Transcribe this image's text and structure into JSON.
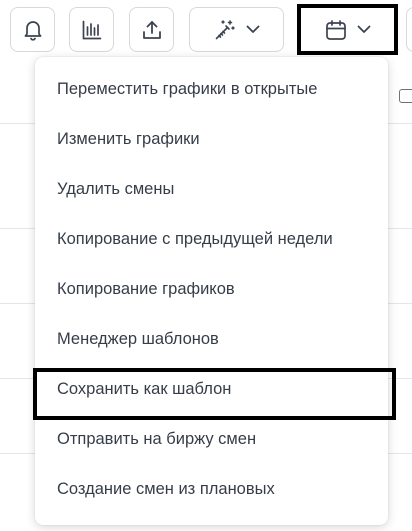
{
  "toolbar": {
    "buttons": [
      {
        "name": "notifications",
        "icon": "bell-icon"
      },
      {
        "name": "statistics",
        "icon": "bar-chart-icon"
      },
      {
        "name": "export",
        "icon": "upload-icon"
      },
      {
        "name": "auto-fill",
        "icon": "magic-wand-icon",
        "dropdown": true
      },
      {
        "name": "schedule-actions",
        "icon": "calendar-icon",
        "dropdown": true,
        "active": true
      }
    ]
  },
  "menu": {
    "items": [
      {
        "label": "Переместить графики в открытые"
      },
      {
        "label": "Изменить графики"
      },
      {
        "label": "Удалить смены"
      },
      {
        "label": "Копирование с предыдущей недели"
      },
      {
        "label": "Копирование графиков"
      },
      {
        "label": "Менеджер шаблонов"
      },
      {
        "label": "Сохранить как шаблон",
        "highlighted": true
      },
      {
        "label": "Отправить на биржу смен"
      },
      {
        "label": "Создание смен из плановых"
      }
    ]
  },
  "colors": {
    "icon": "#3c4350",
    "border": "#d5d9de",
    "text": "#363d48",
    "highlight_outline": "#000000"
  }
}
